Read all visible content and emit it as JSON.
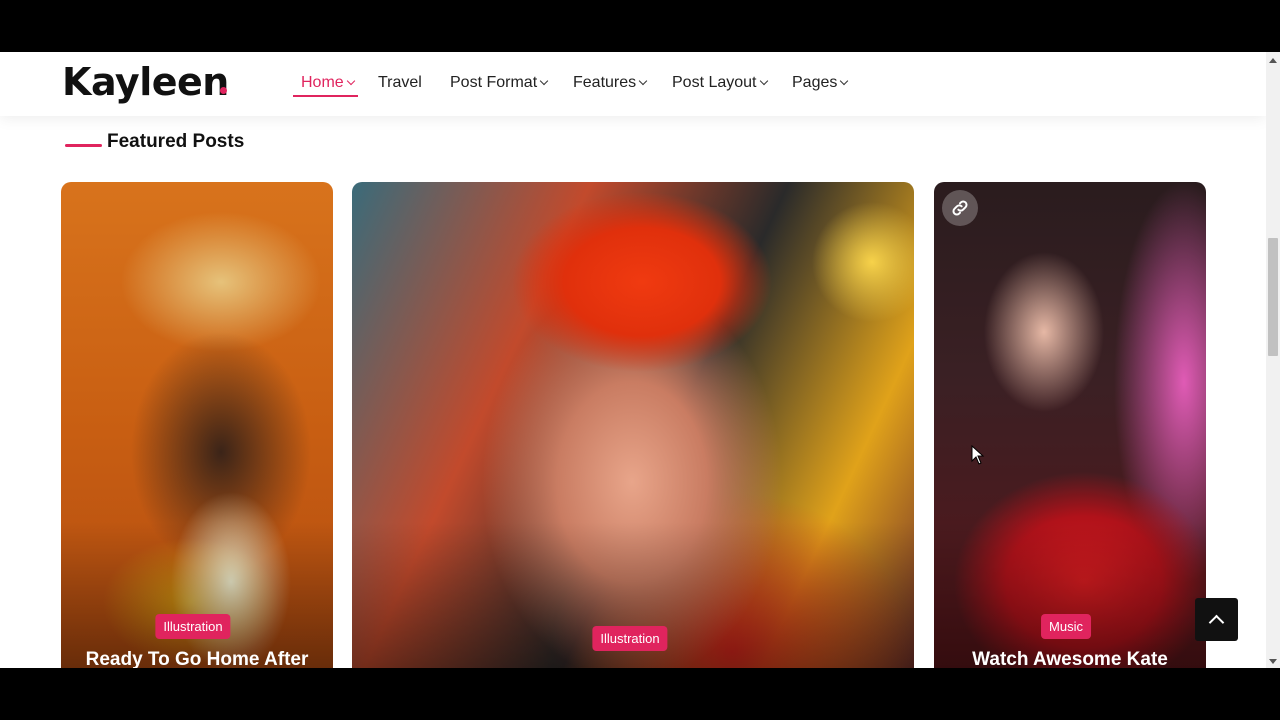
{
  "site": {
    "logo_text": "Kayleen"
  },
  "nav": {
    "items": [
      {
        "label": "Home",
        "dropdown": true,
        "active": true
      },
      {
        "label": "Travel",
        "dropdown": false
      },
      {
        "label": "Post Format",
        "dropdown": true
      },
      {
        "label": "Features",
        "dropdown": true
      },
      {
        "label": "Post Layout",
        "dropdown": true
      },
      {
        "label": "Pages",
        "dropdown": true
      }
    ]
  },
  "section": {
    "title": "Featured Posts"
  },
  "cards": [
    {
      "category": "Illustration",
      "title": "Ready To Go Home After"
    },
    {
      "category": "Illustration",
      "title": ""
    },
    {
      "category": "Music",
      "title": "Watch Awesome Kate",
      "format_icon": "link-icon"
    }
  ],
  "colors": {
    "accent": "#e0245e",
    "text": "#222222"
  },
  "icons": {
    "scroll_top": "chevron-up-icon",
    "nav_dropdown": "chevron-down-icon"
  }
}
